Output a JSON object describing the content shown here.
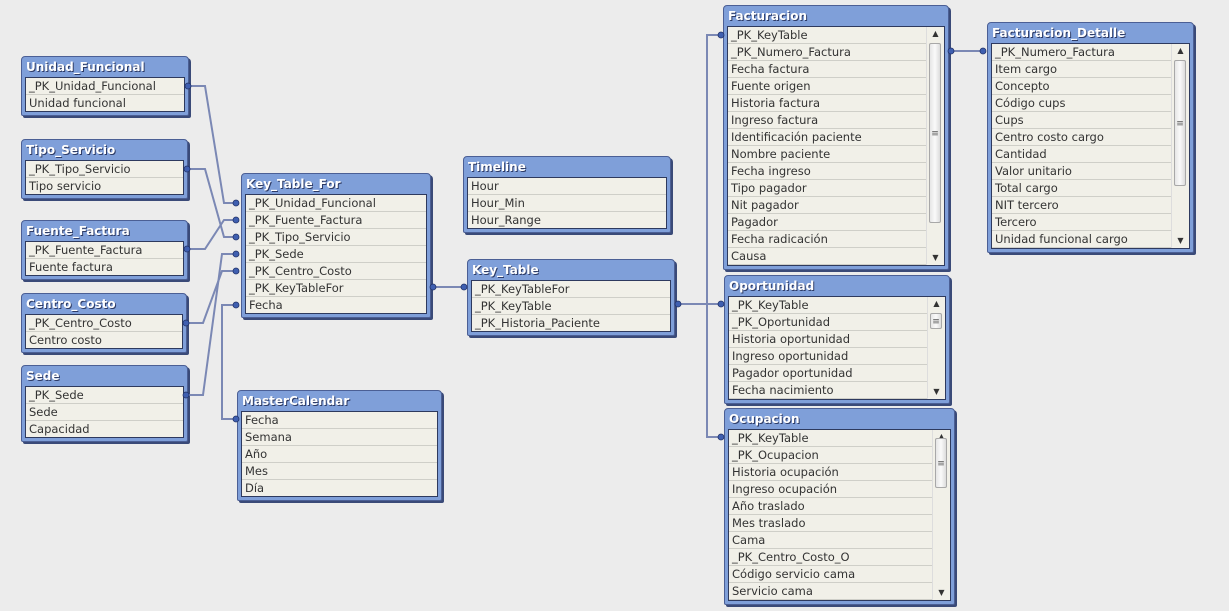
{
  "colors": {
    "header": "#7f9fd9",
    "link": "#7b88b4",
    "row_bg": "#f1f0e8",
    "canvas": "#ececec"
  },
  "tables": [
    {
      "name": "Unidad_Funcional",
      "fields": [
        "_PK_Unidad_Funcional",
        "Unidad funcional"
      ]
    },
    {
      "name": "Tipo_Servicio",
      "fields": [
        "_PK_Tipo_Servicio",
        "Tipo servicio"
      ]
    },
    {
      "name": "Fuente_Factura",
      "fields": [
        "_PK_Fuente_Factura",
        "Fuente factura"
      ]
    },
    {
      "name": "Centro_Costo",
      "fields": [
        "_PK_Centro_Costo",
        "Centro costo"
      ]
    },
    {
      "name": "Sede",
      "fields": [
        "_PK_Sede",
        "Sede",
        "Capacidad"
      ]
    },
    {
      "name": "Key_Table_For",
      "fields": [
        "_PK_Unidad_Funcional",
        "_PK_Fuente_Factura",
        "_PK_Tipo_Servicio",
        "_PK_Sede",
        "_PK_Centro_Costo",
        "_PK_KeyTableFor",
        "Fecha"
      ]
    },
    {
      "name": "MasterCalendar",
      "fields": [
        "Fecha",
        "Semana",
        "Año",
        "Mes",
        "Día"
      ]
    },
    {
      "name": "Timeline",
      "fields": [
        "Hour",
        "Hour_Min",
        "Hour_Range"
      ]
    },
    {
      "name": "Key_Table",
      "fields": [
        "_PK_KeyTableFor",
        "_PK_KeyTable",
        "_PK_Historia_Paciente"
      ]
    },
    {
      "name": "Facturacion",
      "scrollbar": true,
      "fields": [
        "_PK_KeyTable",
        "_PK_Numero_Factura",
        "Fecha factura",
        "Fuente origen",
        "Historia factura",
        "Ingreso factura",
        "Identificación paciente",
        "Nombre paciente",
        "Fecha ingreso",
        "Tipo pagador",
        "Nit pagador",
        "Pagador",
        "Fecha radicación",
        "Causa"
      ]
    },
    {
      "name": "Facturacion_Detalle",
      "scrollbar": true,
      "fields": [
        "_PK_Numero_Factura",
        "Item cargo",
        "Concepto",
        "Código cups",
        "Cups",
        "Centro costo cargo",
        "Cantidad",
        "Valor unitario",
        "Total cargo",
        "NIT tercero",
        "Tercero",
        "Unidad funcional cargo"
      ]
    },
    {
      "name": "Oportunidad",
      "scrollbar": true,
      "fields": [
        "_PK_KeyTable",
        "_PK_Oportunidad",
        "Historia oportunidad",
        "Ingreso oportunidad",
        "Pagador oportunidad",
        "Fecha nacimiento"
      ]
    },
    {
      "name": "Ocupacion",
      "scrollbar": true,
      "fields": [
        "_PK_KeyTable",
        "_PK_Ocupacion",
        "Historia ocupación",
        "Ingreso ocupación",
        "Año traslado",
        "Mes traslado",
        "Cama",
        "_PK_Centro_Costo_O",
        "Código servicio cama",
        "Servicio cama"
      ]
    }
  ]
}
